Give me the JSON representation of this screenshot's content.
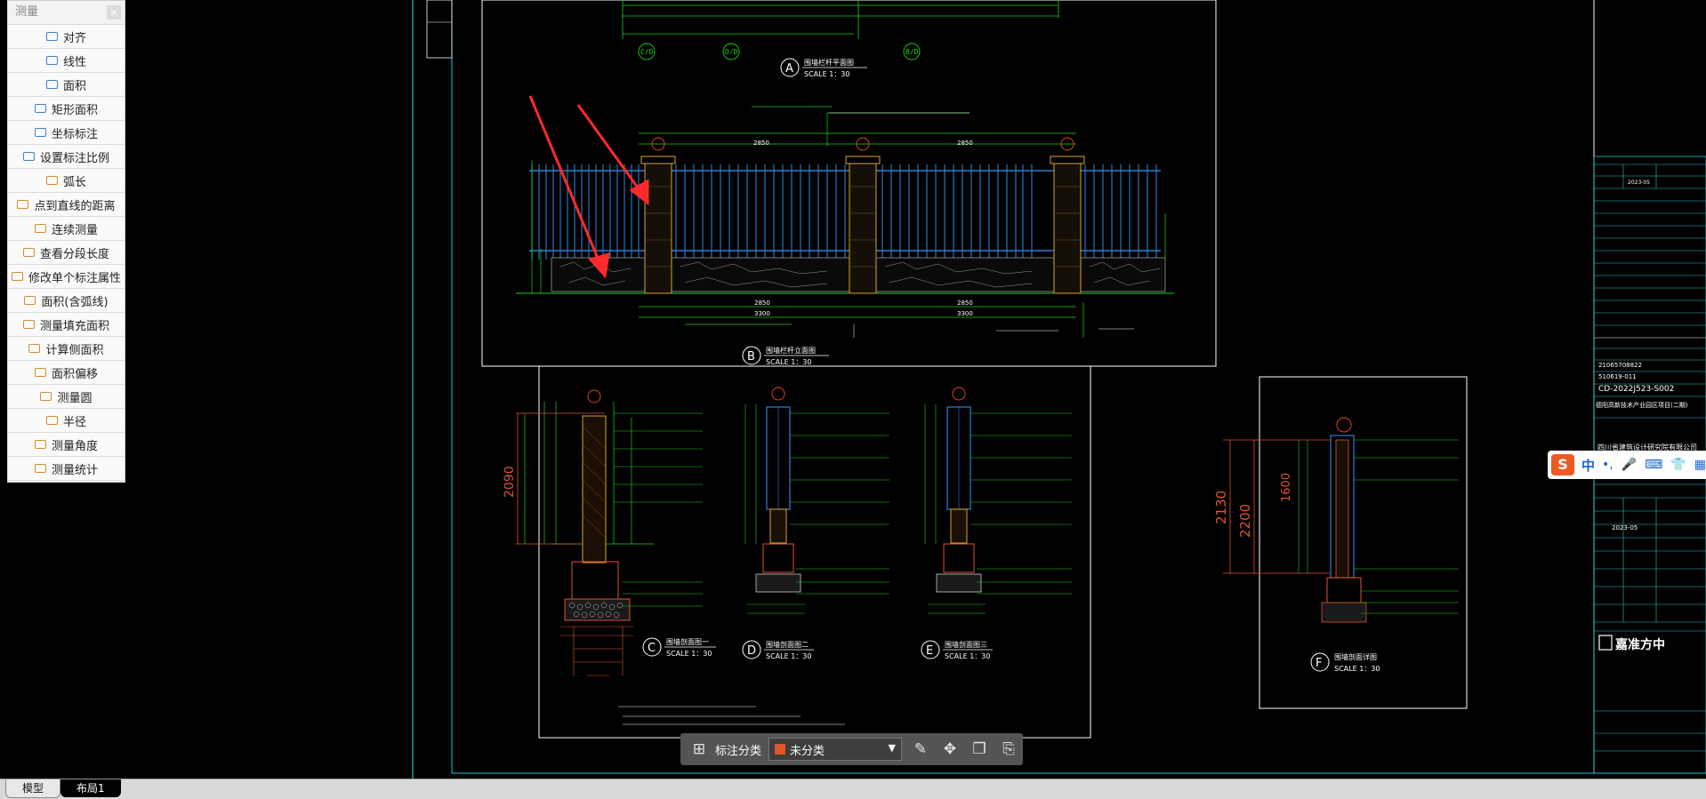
{
  "measure_panel": {
    "title": "测量",
    "close": "×",
    "items": [
      {
        "label": "对齐",
        "icon": "align-icon"
      },
      {
        "label": "线性",
        "icon": "linear-icon"
      },
      {
        "label": "面积",
        "icon": "area-icon"
      },
      {
        "label": "矩形面积",
        "icon": "rect-area-icon"
      },
      {
        "label": "坐标标注",
        "icon": "coordinate-icon"
      },
      {
        "label": "设置标注比例",
        "icon": "scale-icon"
      },
      {
        "label": "弧长",
        "icon": "arc-icon"
      },
      {
        "label": "点到直线的距离",
        "icon": "point-line-icon"
      },
      {
        "label": "连续测量",
        "icon": "continuous-icon"
      },
      {
        "label": "查看分段长度",
        "icon": "segment-icon"
      },
      {
        "label": "修改单个标注属性",
        "icon": "edit-dim-icon"
      },
      {
        "label": "面积(含弧线)",
        "icon": "arc-area-icon"
      },
      {
        "label": "测量填充面积",
        "icon": "fill-area-icon"
      },
      {
        "label": "计算侧面积",
        "icon": "side-area-icon"
      },
      {
        "label": "面积偏移",
        "icon": "area-offset-icon"
      },
      {
        "label": "测量圆",
        "icon": "circle-icon"
      },
      {
        "label": "半径",
        "icon": "radius-icon"
      },
      {
        "label": "测量角度",
        "icon": "angle-icon"
      },
      {
        "label": "测量统计",
        "icon": "stats-icon"
      }
    ]
  },
  "annotation_toolbar": {
    "label": "标注分类",
    "selected": "未分类",
    "selected_color": "#e0552b"
  },
  "tabs": {
    "model": "模型",
    "layout": "布局1"
  },
  "drawing": {
    "sections": [
      {
        "id": "A",
        "title": "围墙栏杆平面图",
        "scale": "SCALE    1：30"
      },
      {
        "id": "B",
        "title": "围墙栏杆立面图",
        "scale": "SCALE    1：30"
      },
      {
        "id": "C",
        "title": "围墙剖面图一",
        "scale": "SCALE    1：30"
      },
      {
        "id": "D",
        "title": "围墙剖面图二",
        "scale": "SCALE    1：30"
      },
      {
        "id": "E",
        "title": "围墙剖面图三",
        "scale": "SCALE    1：30"
      },
      {
        "id": "F",
        "title": "围墙剖面详图",
        "scale": "SCALE    1：30"
      }
    ],
    "dims": {
      "top1": "2850",
      "top2": "3300",
      "bot1": "2850",
      "bot2": "3300",
      "c_height": "2090",
      "f_height": "2130",
      "f_h2": "2200",
      "f_h3": "1600"
    },
    "titleblock": {
      "code1": "21065708822",
      "code2": "510619-011",
      "drawing_no": "CD-2022J523-S002",
      "project": "德阳高新技术产业园区项目(二期)",
      "company": "四川省建筑设计研究院有限公司",
      "date": "2023-05",
      "logo": "嘉准方中"
    }
  },
  "ime": {
    "logo": "S",
    "lang": "中",
    "punct": "•,"
  }
}
